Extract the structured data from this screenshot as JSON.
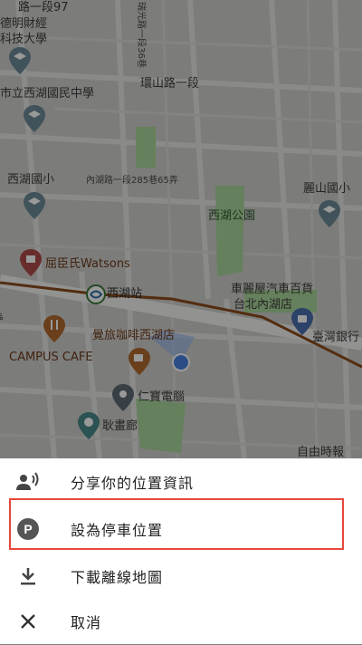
{
  "map": {
    "labels": {
      "road_top": "路一段97",
      "school_top": "德明財經",
      "school_top2": "科技大學",
      "road_vertical": "瑞光路一段36巷",
      "huanshan": "環山路一段",
      "xihu_middle": "市立西湖國民中學",
      "xihu_elem": "西湖國小",
      "neihu_lane": "內湖路一段285巷65弄",
      "lishan": "麗山國小",
      "xihu_park": "西湖公園",
      "watsons": "屈臣氏Watsons",
      "xihu_station": "西湖站",
      "carlish": "車麗屋汽車百貨",
      "carlish2": "台北內湖店",
      "taiwan_bank": "臺灣銀行",
      "cafe_jp": "覺旅咖啡西湖店",
      "campus": "CAMPUS CAFE",
      "renbao": "仁寶電腦",
      "gallery": "耿畫廊",
      "zishi": "自由時報",
      "left_road": "路"
    }
  },
  "menu": {
    "items": [
      {
        "label": "分享你的位置資訊",
        "icon": "share-location-icon"
      },
      {
        "label": "設為停車位置",
        "icon": "parking-icon"
      },
      {
        "label": "下載離線地圖",
        "icon": "download-icon"
      },
      {
        "label": "取消",
        "icon": "close-icon"
      }
    ]
  },
  "colors": {
    "highlight": "#e8483c",
    "location_dot": "#4a7fe0",
    "map_base": "#c9c9c6",
    "park": "#a8d59a"
  }
}
